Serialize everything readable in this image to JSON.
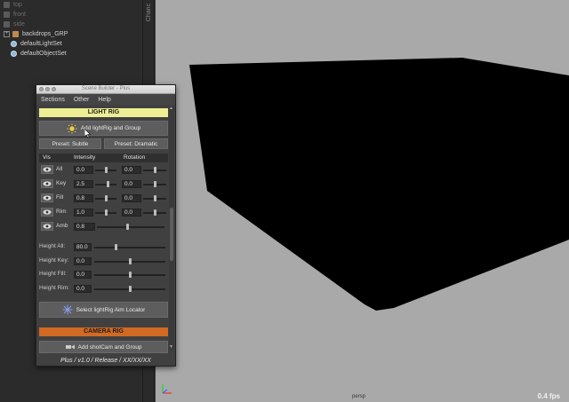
{
  "outliner": {
    "items": [
      {
        "label": "top"
      },
      {
        "label": "front"
      },
      {
        "label": "side"
      },
      {
        "label": "backdrops_GRP"
      },
      {
        "label": "defaultLightSet"
      },
      {
        "label": "defaultObjectSet"
      }
    ]
  },
  "divider": {
    "label": "Chanc"
  },
  "viewport": {
    "camera": "persp",
    "fps": "0.4 fps"
  },
  "scene_builder": {
    "title": "Scene Builder - Plus",
    "menu": [
      "Sections",
      "Other",
      "Help"
    ],
    "light_rig": {
      "header": "LIGHT RIG",
      "add_button": "Add lightRig and Group",
      "preset_subtle": "Preset: Subtle",
      "preset_dramatic": "Preset: Dramatic",
      "columns": [
        "Vis",
        "Intensity",
        "Rotation"
      ],
      "rows": [
        {
          "label": "All",
          "intensity": "0.0",
          "rotation": "0.0",
          "int_frac": 0.5,
          "rot_frac": 0.5
        },
        {
          "label": "Key",
          "intensity": "2.5",
          "rotation": "0.0",
          "int_frac": 0.62,
          "rot_frac": 0.5
        },
        {
          "label": "Fill",
          "intensity": "0.8",
          "rotation": "0.0",
          "int_frac": 0.5,
          "rot_frac": 0.5
        },
        {
          "label": "Rim",
          "intensity": "1.0",
          "rotation": "0.0",
          "int_frac": 0.5,
          "rot_frac": 0.5
        }
      ],
      "amb": {
        "label": "Amb",
        "value": "0.8",
        "frac": 0.45
      },
      "heights": [
        {
          "label": "Height All:",
          "value": "80.0",
          "frac": 0.3
        },
        {
          "label": "Height Key:",
          "value": "0.0",
          "frac": 0.5
        },
        {
          "label": "Height Fill:",
          "value": "0.0",
          "frac": 0.5
        },
        {
          "label": "Height Rim:",
          "value": "0.0",
          "frac": 0.5
        }
      ],
      "aim_button": "Select lightRig Aim Locator"
    },
    "camera_rig": {
      "header": "CAMERA RIG",
      "add_button": "Add shotCam and Group"
    },
    "footer": "Plus  /  v1.0  /  Release  /  XX/XX/XX"
  }
}
